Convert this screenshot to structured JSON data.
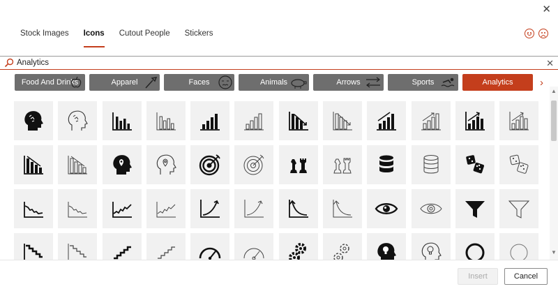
{
  "window": {
    "close_label": "✕"
  },
  "tabs": [
    {
      "label": "Stock Images",
      "active": false
    },
    {
      "label": "Icons",
      "active": true
    },
    {
      "label": "Cutout People",
      "active": false
    },
    {
      "label": "Stickers",
      "active": false
    }
  ],
  "feedback": {
    "positive_icon": "smiley-face-icon",
    "negative_icon": "frown-face-icon"
  },
  "search": {
    "value": "Analytics",
    "placeholder": "Search",
    "clear_label": "✕"
  },
  "categories": [
    {
      "label": "Food And Drinks",
      "icon": "apple-icon"
    },
    {
      "label": "Apparel",
      "icon": "brush-icon"
    },
    {
      "label": "Faces",
      "icon": "face-icon"
    },
    {
      "label": "Animals",
      "icon": "pig-icon"
    },
    {
      "label": "Arrows",
      "icon": "arrows-icon"
    },
    {
      "label": "Sports",
      "icon": "swimmer-icon"
    },
    {
      "label": "Analytics",
      "icon": "chart-icon",
      "active": true
    }
  ],
  "category_next_label": "›",
  "icons": [
    "head-brain-icon",
    "head-brain-outline-icon",
    "bar-chart-icon",
    "bar-chart-outline-icon",
    "bar-chart-rising-icon",
    "bar-chart-rising-outline-icon",
    "bar-chart-falling-icon",
    "bar-chart-falling-outline-icon",
    "bar-chart-growth-icon",
    "bar-chart-growth-outline-icon",
    "bar-chart-arrow-up-icon",
    "bar-chart-arrow-up-outline-icon",
    "bar-chart-decline-icon",
    "bar-chart-decline-outline-icon",
    "head-location-icon",
    "head-location-outline-icon",
    "target-icon",
    "target-outline-icon",
    "chess-pieces-icon",
    "chess-pieces-outline-icon",
    "database-icon",
    "database-outline-icon",
    "dice-icon",
    "dice-outline-icon",
    "line-chart-down-icon",
    "line-chart-down-outline-icon",
    "line-chart-up-icon",
    "line-chart-up-outline-icon",
    "curve-up-icon",
    "curve-up-outline-icon",
    "curve-down-icon",
    "curve-down-outline-icon",
    "eye-icon",
    "eye-outline-icon",
    "funnel-icon",
    "funnel-outline-icon",
    "step-chart-down-icon",
    "step-chart-down-outline-icon",
    "step-chart-up-icon",
    "step-chart-up-outline-icon",
    "gauge-icon",
    "gauge-outline-icon",
    "gears-icon",
    "gears-outline-icon",
    "head-lightbulb-icon",
    "head-lightbulb-outline-icon",
    "circle-icon",
    "circle-outline-icon"
  ],
  "buttons": {
    "insert_label": "Insert",
    "cancel_label": "Cancel"
  },
  "colors": {
    "accent": "#c43e1c",
    "category_bg": "#6e6e6e",
    "tile_bg": "#f1f1f1"
  }
}
